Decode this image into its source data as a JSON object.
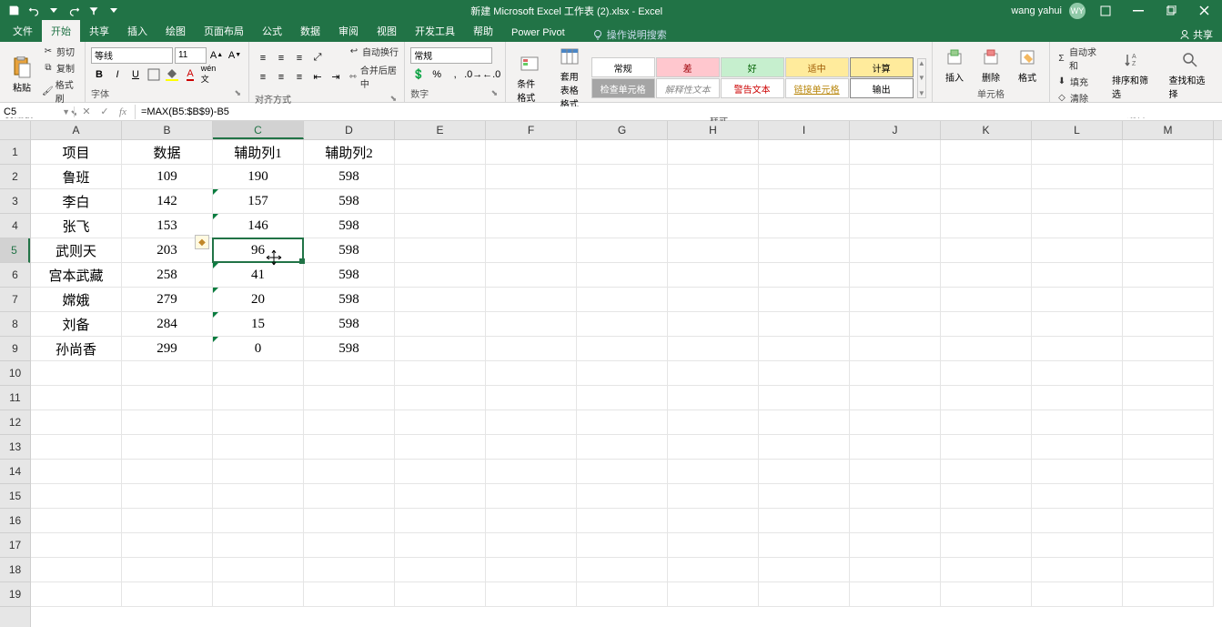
{
  "titlebar": {
    "title": "新建 Microsoft Excel 工作表 (2).xlsx  -  Excel",
    "user": "wang yahui",
    "avatar": "WY"
  },
  "tabs": [
    "文件",
    "开始",
    "共享",
    "插入",
    "绘图",
    "页面布局",
    "公式",
    "数据",
    "审阅",
    "视图",
    "开发工具",
    "帮助",
    "Power Pivot"
  ],
  "active_tab": 1,
  "tellme": "操作说明搜索",
  "share": "共享",
  "clipboard": {
    "paste": "粘贴",
    "cut": "剪切",
    "copy": "复制",
    "fmt": "格式刷",
    "label": "剪贴板"
  },
  "font": {
    "name": "等线",
    "size": "11",
    "label": "字体"
  },
  "align": {
    "wrap": "自动换行",
    "merge": "合并后居中",
    "label": "对齐方式"
  },
  "number": {
    "format": "常规",
    "label": "数字"
  },
  "styles": {
    "cond": "条件格式",
    "table": "套用\n表格格式",
    "gallery": [
      [
        "常规",
        "差",
        "好",
        "适中",
        "计算"
      ],
      [
        "检查单元格",
        "解释性文本",
        "警告文本",
        "链接单元格",
        "输出"
      ]
    ],
    "label": "样式"
  },
  "cells": {
    "insert": "插入",
    "delete": "删除",
    "format": "格式",
    "label": "单元格"
  },
  "editing": {
    "sum": "自动求和",
    "fill": "填充",
    "clear": "清除",
    "sort": "排序和筛选",
    "find": "查找和选择",
    "label": "编辑"
  },
  "namebox": "C5",
  "formula": "=MAX(B5:$B$9)-B5",
  "columns": [
    "A",
    "B",
    "C",
    "D",
    "E",
    "F",
    "G",
    "H",
    "I",
    "J",
    "K",
    "L",
    "M"
  ],
  "active_col": 2,
  "active_row": 4,
  "rows": 19,
  "chart_data": {
    "type": "table",
    "headers": [
      "项目",
      "数据",
      "辅助列1",
      "辅助列2"
    ],
    "rows": [
      [
        "鲁班",
        109,
        190,
        598
      ],
      [
        "李白",
        142,
        157,
        598
      ],
      [
        "张飞",
        153,
        146,
        598
      ],
      [
        "武则天",
        203,
        96,
        598
      ],
      [
        "宫本武藏",
        258,
        41,
        598
      ],
      [
        "嫦娥",
        279,
        20,
        598
      ],
      [
        "刘备",
        284,
        15,
        598
      ],
      [
        "孙尚香",
        299,
        0,
        598
      ]
    ]
  },
  "error_triangle_rows": [
    2,
    3,
    5,
    6,
    7,
    8
  ],
  "selection": {
    "col": 2,
    "row": 4
  },
  "trace_btn": {
    "col": 1,
    "row": 4
  }
}
